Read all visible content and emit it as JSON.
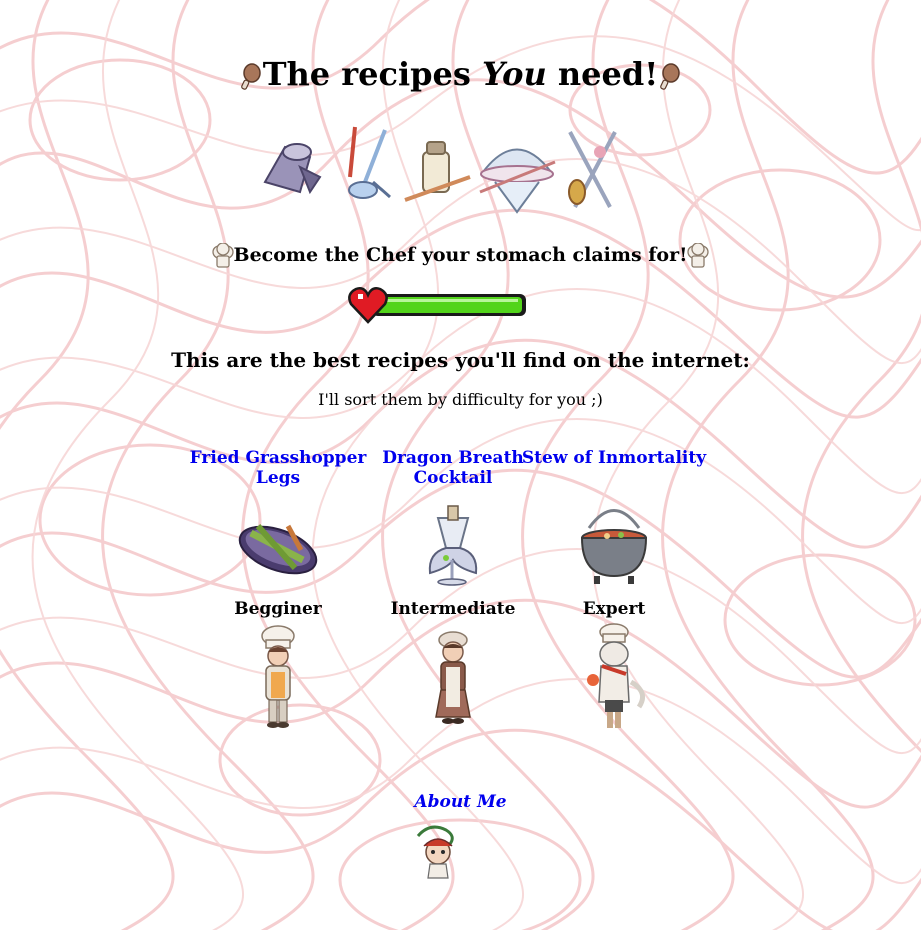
{
  "header": {
    "title_part1": "The recipes ",
    "title_em": "You",
    "title_part2": " need!",
    "subtitle": "Become the Chef your stomach claims for!"
  },
  "main": {
    "heading": "This are the best recipes you'll find on the internet:",
    "note": "I'll sort them by difficulty for you ;)",
    "recipes": [
      {
        "name": "Fried Grasshopper Legs",
        "level": "Begginer"
      },
      {
        "name": "Dragon Breath Cocktail",
        "level": "Intermediate"
      },
      {
        "name": "Stew of Inmortality",
        "level": "Expert"
      }
    ],
    "about_label": "About Me"
  },
  "colors": {
    "link": "#0000ee",
    "noodle_pattern": "#f4c6c8",
    "health_bar": "#52d41a",
    "heart": "#e01b24"
  },
  "icons": [
    "drumstick-icon",
    "chef-hat-icon",
    "ladle-icon",
    "salt-shaker-icon",
    "cloche-icon",
    "kitchen-tools-icon",
    "heart-icon",
    "health-bar-icon"
  ]
}
